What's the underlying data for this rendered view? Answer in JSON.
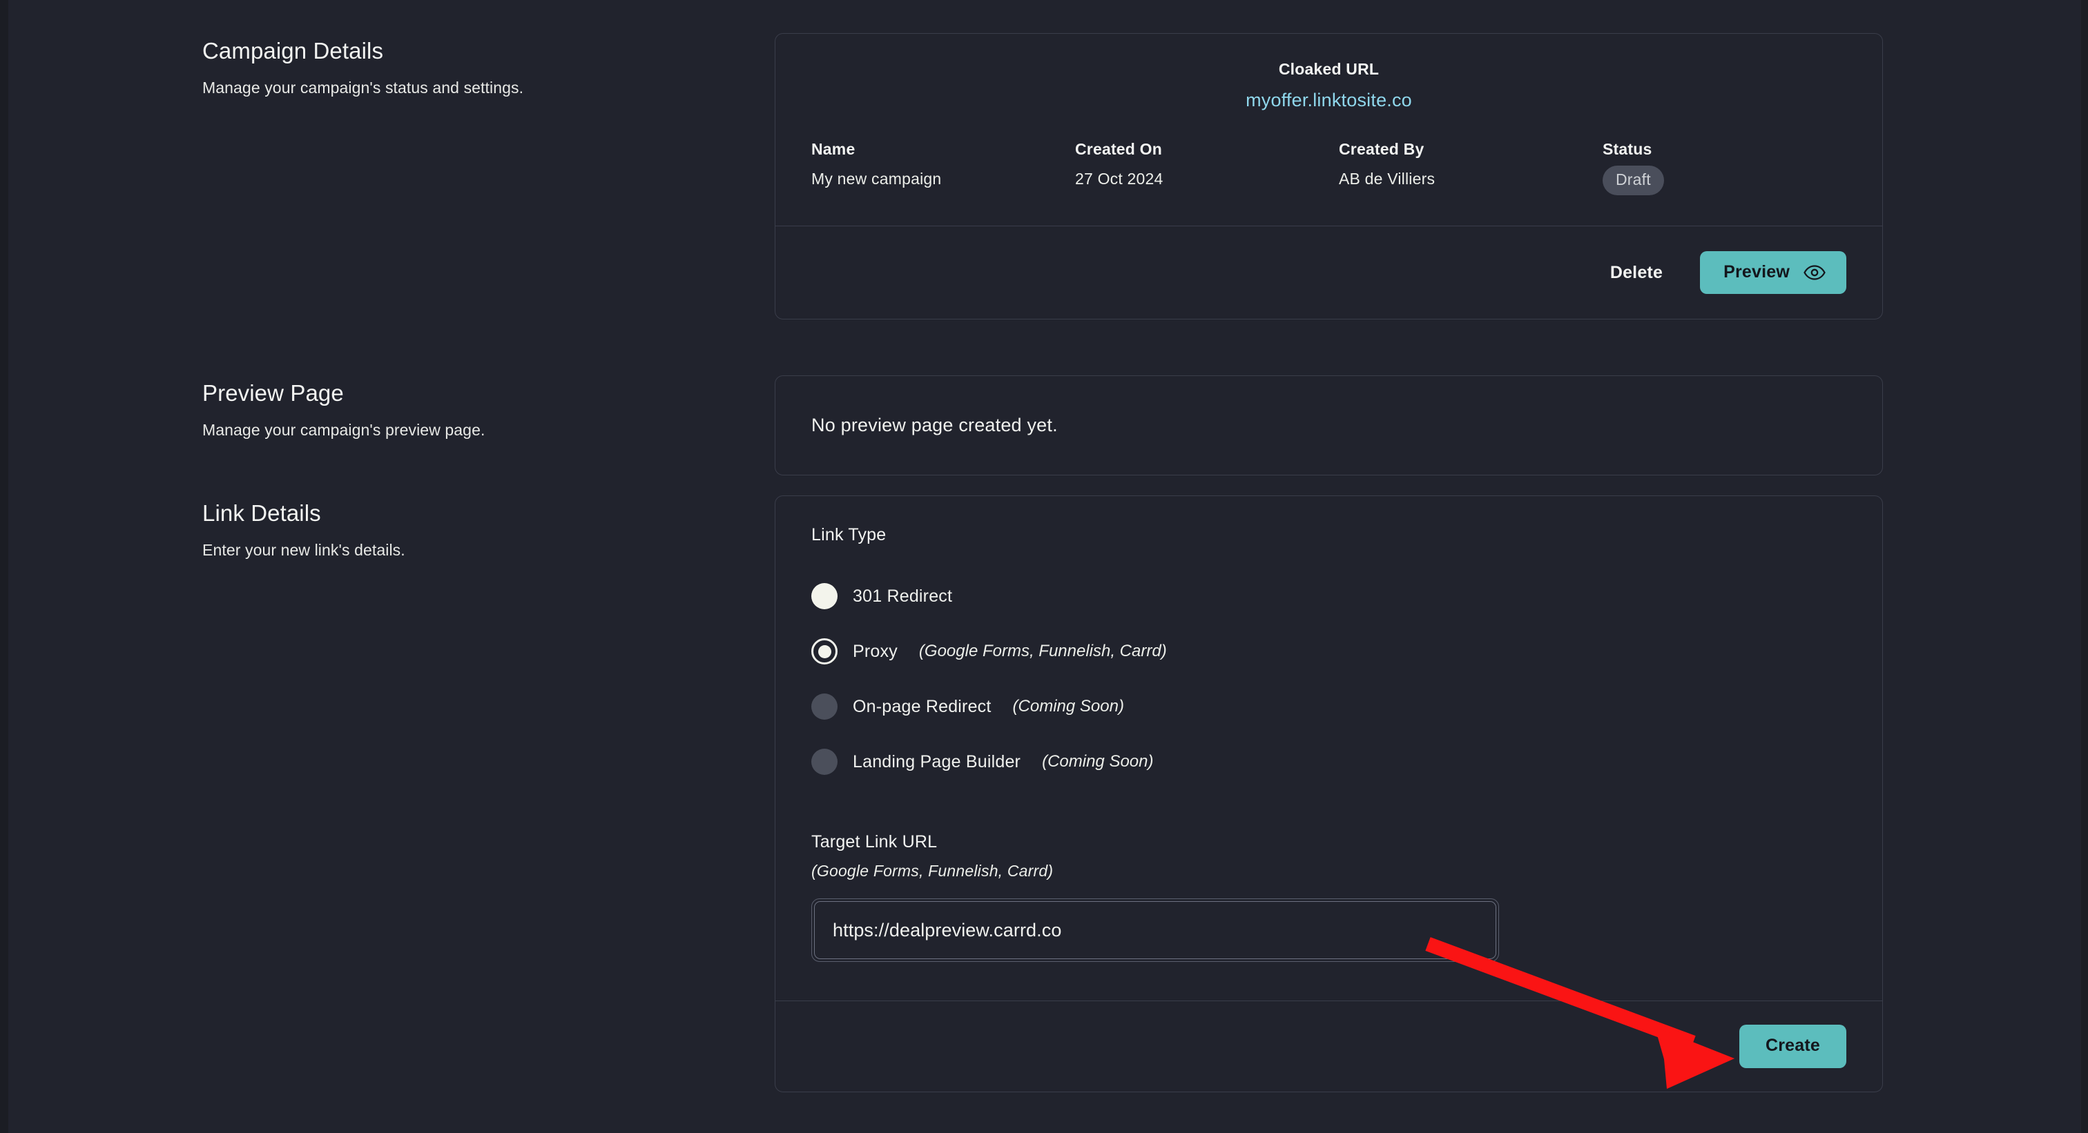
{
  "sections": [
    {
      "title": "Campaign Details",
      "subtitle": "Manage your campaign's status and settings."
    },
    {
      "title": "Preview Page",
      "subtitle": "Manage your campaign's preview page."
    },
    {
      "title": "Link Details",
      "subtitle": "Enter your new link's details."
    }
  ],
  "campaign": {
    "cloaked_url_label": "Cloaked URL",
    "cloaked_url_value": "myoffer.linktosite.co",
    "fields": [
      {
        "label": "Name",
        "value": "My new campaign"
      },
      {
        "label": "Created On",
        "value": "27 Oct 2024"
      },
      {
        "label": "Created By",
        "value": "AB de Villiers"
      }
    ],
    "status_label": "Status",
    "status_value": "Draft",
    "delete_label": "Delete",
    "preview_label": "Preview"
  },
  "preview_page": {
    "empty_message": "No preview page created yet."
  },
  "link_details": {
    "link_type_label": "Link Type",
    "options": [
      {
        "label": "301 Redirect",
        "note": "",
        "state": "filled"
      },
      {
        "label": "Proxy",
        "note": "(Google Forms, Funnelish, Carrd)",
        "state": "selected"
      },
      {
        "label": "On-page Redirect",
        "note": "(Coming Soon)",
        "state": "disabled"
      },
      {
        "label": "Landing Page Builder",
        "note": "(Coming Soon)",
        "state": "disabled"
      }
    ],
    "target_label": "Target Link URL",
    "target_note": "(Google Forms, Funnelish, Carrd)",
    "target_value": "https://dealpreview.carrd.co",
    "target_placeholder": "https://",
    "create_label": "Create"
  },
  "icons": {
    "preview": "eye-icon",
    "annotation": "red-arrow-annotation"
  },
  "colors": {
    "page_background": "#21232d",
    "card_border": "#3a3d4a",
    "accent_teal": "#5cbdbd",
    "link_blue": "#8fd7ec",
    "badge_gray": "#4a4e5b",
    "annotation_red": "#fa1414"
  }
}
